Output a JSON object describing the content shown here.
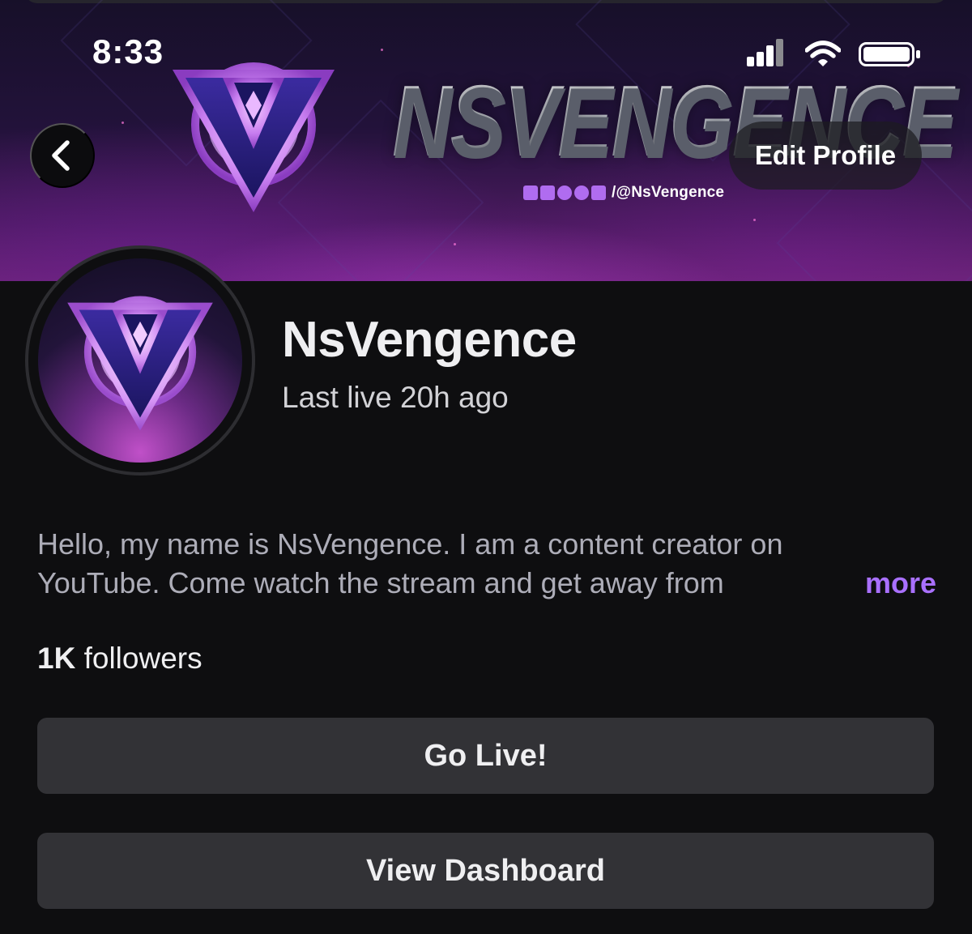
{
  "status_bar": {
    "time": "8:33",
    "icons": [
      "signal-icon",
      "wifi-icon",
      "battery-icon"
    ]
  },
  "banner": {
    "title": "NSVENGENCE",
    "social_handle": "/@NsVengence",
    "social_icons": [
      "twitch-icon",
      "youtube-icon",
      "instagram-icon",
      "twitter-icon",
      "tiktok-icon"
    ]
  },
  "nav": {
    "back_icon": "chevron-left-icon",
    "edit_profile_label": "Edit Profile"
  },
  "profile": {
    "channel_name": "NsVengence",
    "last_live": "Last live 20h ago",
    "bio_line1": "Hello, my name is NsVengence. I am a content creator on",
    "bio_line2": "YouTube. Come watch the stream and get away from",
    "more_label": "more",
    "followers_count": "1K",
    "followers_label": "followers"
  },
  "actions": {
    "go_live_label": "Go Live!",
    "dashboard_label": "View Dashboard"
  },
  "colors": {
    "background": "#0e0e10",
    "accent": "#a970ff",
    "button": "#323236",
    "text": "#efeff1",
    "muted_text": "#adadb8"
  }
}
